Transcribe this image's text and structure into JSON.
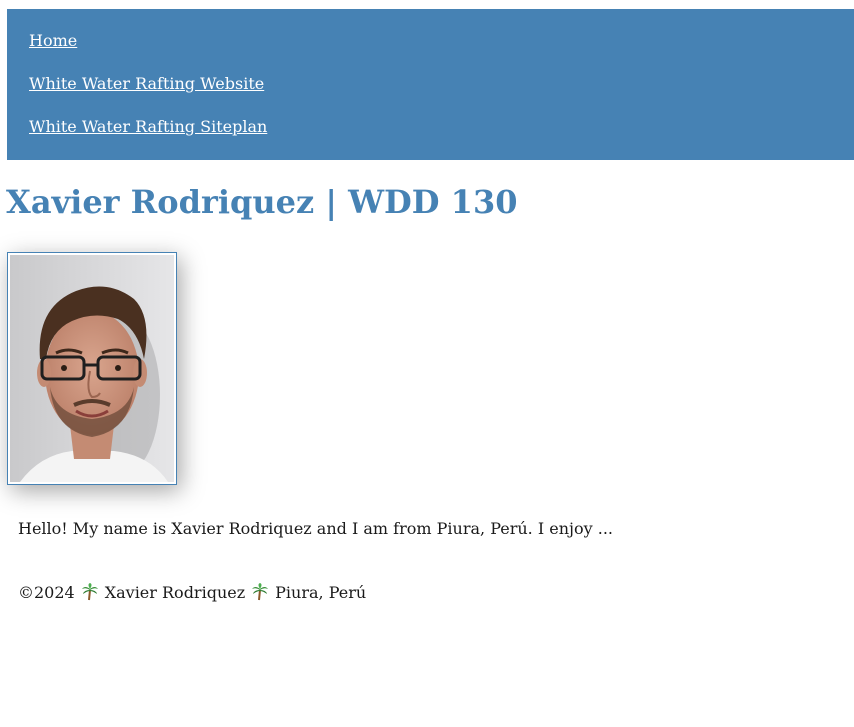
{
  "nav": {
    "items": [
      {
        "label": "Home"
      },
      {
        "label": "White Water Rafting Website"
      },
      {
        "label": "White Water Rafting Siteplan"
      }
    ]
  },
  "page": {
    "title": "Xavier Rodriquez | WDD 130"
  },
  "profile": {
    "intro": "Hello! My name is Xavier Rodriquez and I am from Piura, Perú. I enjoy ..."
  },
  "footer": {
    "copyright": "©2024",
    "name": "Xavier Rodriquez",
    "location": "Piura, Perú",
    "separator_icon": "palm-tree-icon"
  },
  "colors": {
    "accent": "#4682b4",
    "nav_text": "#ffffff",
    "body_text": "#1a1a1a"
  }
}
